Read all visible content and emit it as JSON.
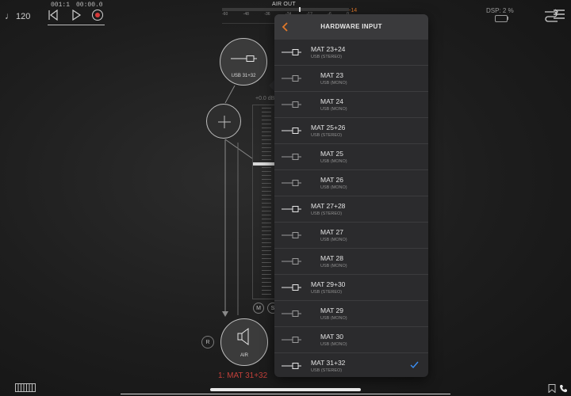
{
  "topbar": {
    "tempo": "120",
    "tempo_icon": "note-icon",
    "position_bars": "001:1",
    "position_time": "00:00.0",
    "meter": {
      "title": "AIR OUT",
      "ticks": [
        "-60",
        "-48",
        "-36",
        "-24",
        "-12",
        "-6",
        "0"
      ],
      "peak": "-14",
      "peak_color": "#e0782a"
    },
    "dsp": "DSP: 2 %"
  },
  "channel": {
    "input_label": "USB 31+32",
    "output_label": "AIR",
    "gain_label": "+0.0 dB",
    "mute_label": "M",
    "solo_label": "S",
    "record_label": "R",
    "name": "1: MAT 31+32",
    "name_color": "#c2403a"
  },
  "popover": {
    "title": "HARDWARE INPUT",
    "accent_color": "#e0782a",
    "check_color": "#3b8ff5",
    "items": [
      {
        "title": "MAT 23+24",
        "subtitle": "USB (STEREO)",
        "stereo": true,
        "selected": false
      },
      {
        "title": "MAT 23",
        "subtitle": "USB (MONO)",
        "stereo": false,
        "selected": false
      },
      {
        "title": "MAT 24",
        "subtitle": "USB (MONO)",
        "stereo": false,
        "selected": false
      },
      {
        "title": "MAT 25+26",
        "subtitle": "USB (STEREO)",
        "stereo": true,
        "selected": false
      },
      {
        "title": "MAT 25",
        "subtitle": "USB (MONO)",
        "stereo": false,
        "selected": false
      },
      {
        "title": "MAT 26",
        "subtitle": "USB (MONO)",
        "stereo": false,
        "selected": false
      },
      {
        "title": "MAT 27+28",
        "subtitle": "USB (STEREO)",
        "stereo": true,
        "selected": false
      },
      {
        "title": "MAT 27",
        "subtitle": "USB (MONO)",
        "stereo": false,
        "selected": false
      },
      {
        "title": "MAT 28",
        "subtitle": "USB (MONO)",
        "stereo": false,
        "selected": false
      },
      {
        "title": "MAT 29+30",
        "subtitle": "USB (STEREO)",
        "stereo": true,
        "selected": false
      },
      {
        "title": "MAT 29",
        "subtitle": "USB (MONO)",
        "stereo": false,
        "selected": false
      },
      {
        "title": "MAT 30",
        "subtitle": "USB (MONO)",
        "stereo": false,
        "selected": false
      },
      {
        "title": "MAT 31+32",
        "subtitle": "USB (STEREO)",
        "stereo": true,
        "selected": true
      }
    ]
  }
}
